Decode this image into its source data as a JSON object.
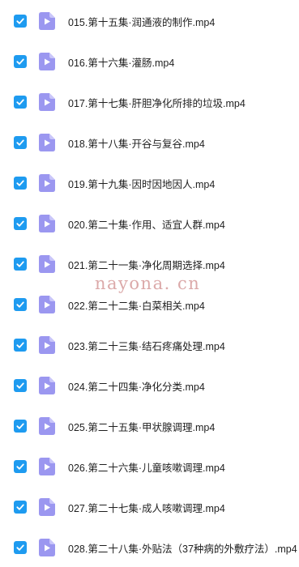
{
  "files": [
    {
      "name": "015.第十五集·润通液的制作.mp4"
    },
    {
      "name": "016.第十六集·灌肠.mp4"
    },
    {
      "name": "017.第十七集·肝胆净化所排的垃圾.mp4"
    },
    {
      "name": "018.第十八集·开谷与复谷.mp4"
    },
    {
      "name": "019.第十九集·因时因地因人.mp4"
    },
    {
      "name": "020.第二十集·作用、适宜人群.mp4"
    },
    {
      "name": "021.第二十一集·净化周期选择.mp4"
    },
    {
      "name": "022.第二十二集·白菜相关.mp4"
    },
    {
      "name": "023.第二十三集·结石疼痛处理.mp4"
    },
    {
      "name": "024.第二十四集·净化分类.mp4"
    },
    {
      "name": "025.第二十五集·甲状腺调理.mp4"
    },
    {
      "name": "026.第二十六集·儿童咳嗽调理.mp4"
    },
    {
      "name": "027.第二十七集·成人咳嗽调理.mp4"
    },
    {
      "name": "028.第二十八集·外贴法（37种病的外敷疗法）.mp4"
    }
  ],
  "watermark": "nayona. cn",
  "colors": {
    "checkbox": "#1e9bf0",
    "file_icon": "#9b97f0",
    "file_icon_fold": "#c9c6fa",
    "text": "#1f1f1f",
    "watermark": "#d8a0a0"
  },
  "icons": {
    "checkbox": "check-icon",
    "file": "video-file-icon"
  }
}
